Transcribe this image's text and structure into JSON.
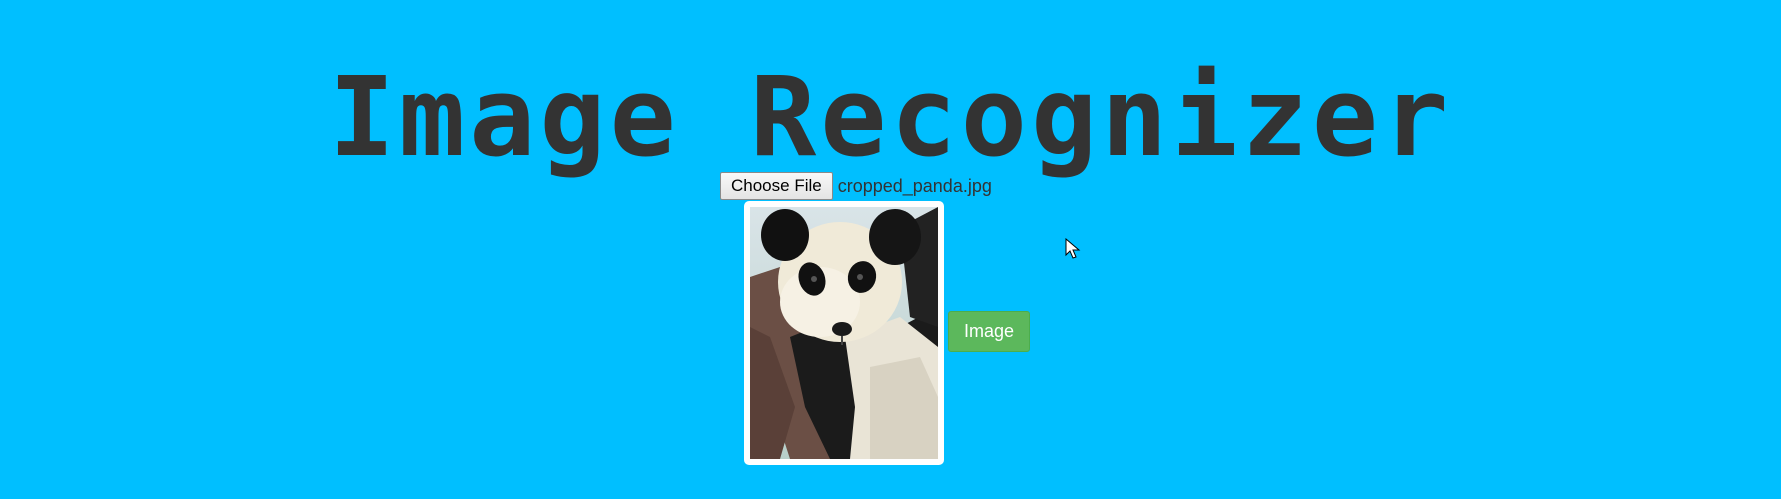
{
  "page": {
    "title": "Image Recognizer",
    "background_color": "#00bfff"
  },
  "file_input": {
    "button_label": "Choose File",
    "selected_file": "cropped_panda.jpg"
  },
  "preview": {
    "image_description": "panda-photo"
  },
  "action_button": {
    "label": "Image",
    "color": "#5cb85c"
  },
  "cursor": {
    "icon": "mouse-pointer-icon"
  }
}
